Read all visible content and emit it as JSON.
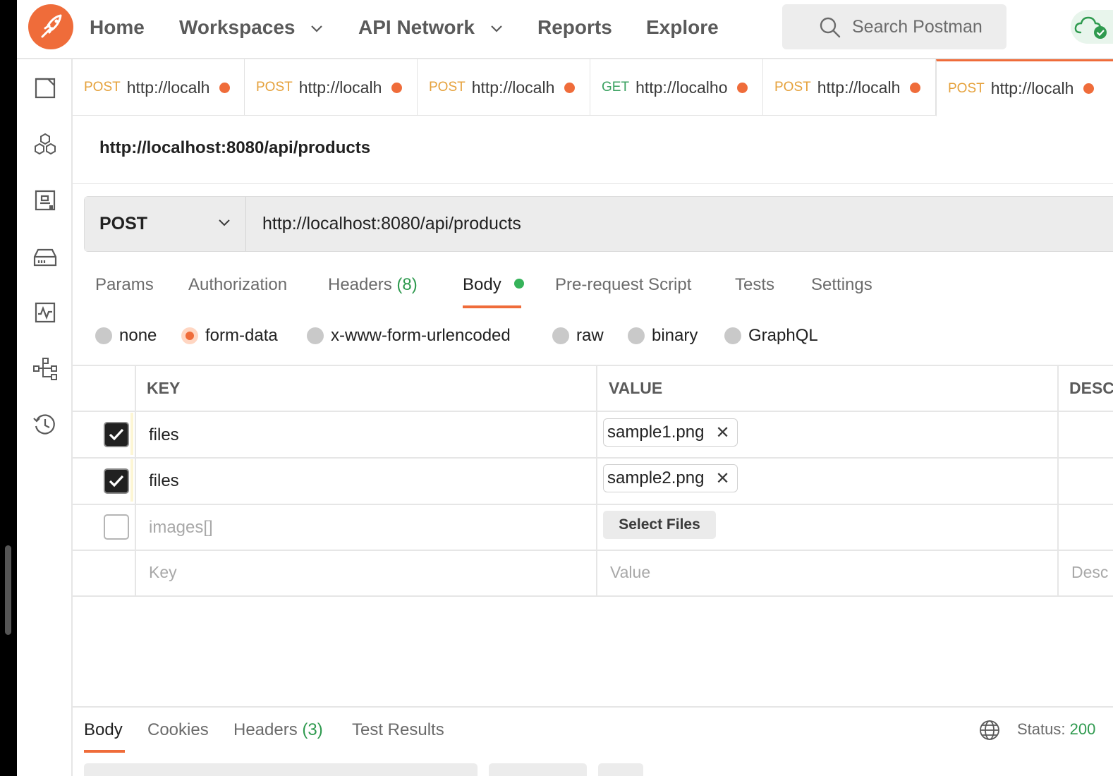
{
  "topbar": {
    "nav": [
      {
        "label": "Home",
        "has_chevron": false
      },
      {
        "label": "Workspaces",
        "has_chevron": true
      },
      {
        "label": "API Network",
        "has_chevron": true
      },
      {
        "label": "Reports",
        "has_chevron": false
      },
      {
        "label": "Explore",
        "has_chevron": false
      }
    ],
    "search_placeholder": "Search Postman"
  },
  "siderail": {
    "icons": [
      "collections-icon",
      "apis-icon",
      "environments-icon",
      "mock-servers-icon",
      "monitors-icon",
      "flows-icon",
      "history-icon"
    ]
  },
  "tabs": [
    {
      "method": "POST",
      "url": "http://localh",
      "unsaved": true,
      "active": false
    },
    {
      "method": "POST",
      "url": "http://localh",
      "unsaved": true,
      "active": false
    },
    {
      "method": "POST",
      "url": "http://localh",
      "unsaved": true,
      "active": false
    },
    {
      "method": "GET",
      "url": "http://localho",
      "unsaved": true,
      "active": false
    },
    {
      "method": "POST",
      "url": "http://localh",
      "unsaved": true,
      "active": false
    },
    {
      "method": "POST",
      "url": "http://localh",
      "unsaved": true,
      "active": true
    }
  ],
  "request": {
    "title": "http://localhost:8080/api/products",
    "method": "POST",
    "url": "http://localhost:8080/api/products",
    "tabs": {
      "params": "Params",
      "authorization": "Authorization",
      "headers": "Headers",
      "headers_count": "(8)",
      "body": "Body",
      "pre_request": "Pre-request Script",
      "tests": "Tests",
      "settings": "Settings"
    },
    "body_types": {
      "none": "none",
      "form_data": "form-data",
      "urlencoded": "x-www-form-urlencoded",
      "raw": "raw",
      "binary": "binary",
      "graphql": "GraphQL",
      "selected": "form-data"
    },
    "table": {
      "headers": {
        "key": "KEY",
        "value": "VALUE",
        "description": "DESC"
      },
      "rows": [
        {
          "key": "files",
          "value": "sample1.png",
          "checked": true
        },
        {
          "key": "files",
          "value": "sample2.png",
          "checked": true
        },
        {
          "key": "images[]",
          "value_button": "Select Files",
          "checked": false
        }
      ],
      "new_row": {
        "key_placeholder": "Key",
        "value_placeholder": "Value",
        "description_placeholder": "Desc"
      },
      "remove_glyph": "✕"
    }
  },
  "response": {
    "tabs": {
      "body": "Body",
      "cookies": "Cookies",
      "headers": "Headers",
      "headers_count": "(3)",
      "test_results": "Test Results"
    },
    "status_label": "Status:",
    "status_code": "200"
  },
  "colors": {
    "accent": "#ef6c3a",
    "post": "#e5a13b",
    "get": "#3aa160",
    "success": "#2f9a4f"
  }
}
